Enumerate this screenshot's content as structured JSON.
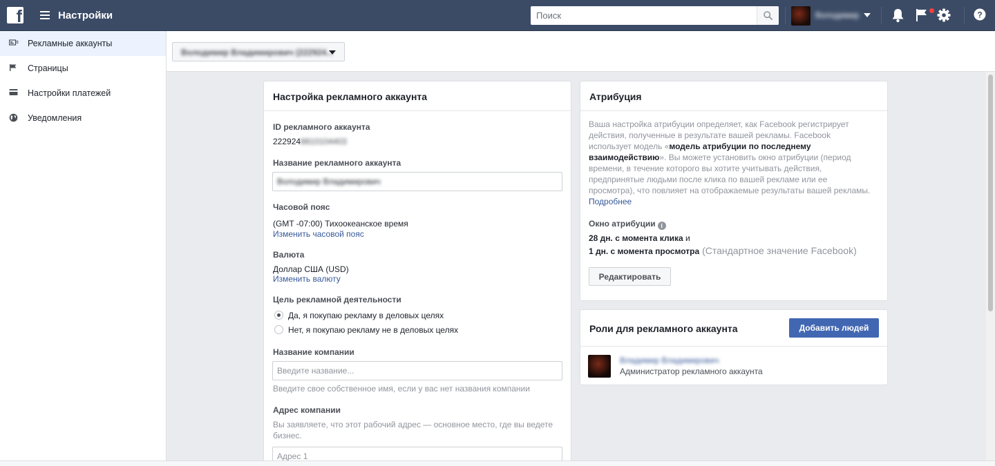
{
  "topbar": {
    "title": "Настройки",
    "search_placeholder": "Поиск",
    "username": "Володимир"
  },
  "sidebar": {
    "items": [
      {
        "label": "Рекламные аккаунты",
        "icon": "ad-account-icon",
        "active": true
      },
      {
        "label": "Страницы",
        "icon": "flag-icon",
        "active": false
      },
      {
        "label": "Настройки платежей",
        "icon": "credit-card-icon",
        "active": false
      },
      {
        "label": "Уведомления",
        "icon": "globe-icon",
        "active": false
      }
    ]
  },
  "account_selector": {
    "label": "Володимир Владимирович (222924..."
  },
  "settings": {
    "title": "Настройка рекламного аккаунта",
    "account_id_label": "ID рекламного аккаунта",
    "account_id_value": "222924",
    "account_id_hidden": "8810104403",
    "account_name_label": "Название рекламного аккаунта",
    "account_name_value": "Володимир Владимирович",
    "timezone_label": "Часовой пояс",
    "timezone_value": "(GMT -07:00) Тихоокеанское время",
    "timezone_change": "Изменить часовой пояс",
    "currency_label": "Валюта",
    "currency_value": "Доллар США (USD)",
    "currency_change": "Изменить валюту",
    "purpose_label": "Цель рекламной деятельности",
    "purpose_yes": "Да, я покупаю рекламу в деловых целях",
    "purpose_no": "Нет, я покупаю рекламу не в деловых целях",
    "company_label": "Название компании",
    "company_placeholder": "Введите название...",
    "company_hint": "Введите свое собственное имя, если у вас нет названия компании",
    "address_label": "Адрес компании",
    "address_hint": "Вы заявляете, что этот рабочий адрес — основное место, где вы ведете бизнес.",
    "address_placeholder": "Адрес 1"
  },
  "attribution": {
    "title": "Атрибуция",
    "text_1": "Ваша настройка атрибуции определяет, как Facebook регистрирует действия, полученные в результате вашей рекламы. Facebook использует модель «",
    "text_bold": "модель атрибуции по последнему взаимодействию",
    "text_2": "». Вы можете установить окно атрибуции (период времени, в течение которого вы хотите учитывать действия, предпринятые людьми после клика по вашей рекламе или ее просмотра), что повлияет на отображаемые результаты вашей рекламы. ",
    "more_link": "Подробнее",
    "window_label": "Окно атрибуции",
    "window_click": "28 дн. с момента клика",
    "window_and": " и",
    "window_view": "1 дн. с момента просмотра",
    "window_default": " (Стандартное значение Facebook)",
    "edit_button": "Редактировать"
  },
  "roles": {
    "title": "Роли для рекламного аккаунта",
    "add_button": "Добавить людей",
    "people": [
      {
        "name": "Владимир Владимирович",
        "role": "Администратор рекламного аккаунта"
      }
    ]
  },
  "colors": {
    "topbar": "#3b4b66",
    "link": "#365899",
    "primary_button": "#4267b2",
    "notification_badge": "#fa3e3e"
  }
}
